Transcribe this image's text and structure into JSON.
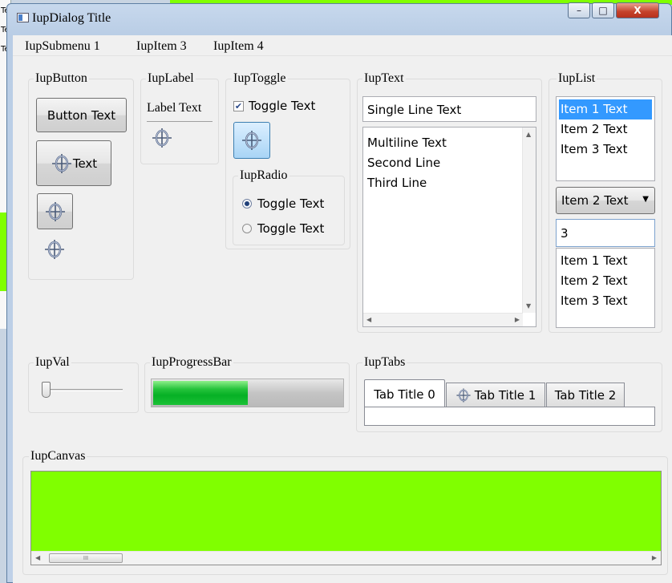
{
  "window": {
    "title": "IupDialog Title",
    "minimize": "–",
    "maximize": "□",
    "close": "X"
  },
  "menu": [
    "IupSubmenu 1",
    "IupItem 3",
    "IupItem 4"
  ],
  "button_group": {
    "label": "IupButton",
    "text_button": "Button Text",
    "icon_text_button": "Text"
  },
  "label_group": {
    "label": "IupLabel",
    "text": "Label Text"
  },
  "toggle_group": {
    "label": "IupToggle",
    "check_label": "Toggle Text",
    "checked": true
  },
  "radio_group": {
    "label": "IupRadio",
    "options": [
      {
        "label": "Toggle Text",
        "selected": true
      },
      {
        "label": "Toggle Text",
        "selected": false
      }
    ]
  },
  "text_group": {
    "label": "IupText",
    "single_line": "Single Line Text",
    "multiline": [
      "Multiline Text",
      "Second Line",
      "Third Line"
    ]
  },
  "list_group": {
    "label": "IupList",
    "list_items": [
      "Item 1 Text",
      "Item 2 Text",
      "Item 3 Text"
    ],
    "selected_index": 0,
    "dropdown_value": "Item 2 Text",
    "edit_value": "3",
    "edit_list_items": [
      "Item 1 Text",
      "Item 2 Text",
      "Item 3 Text"
    ]
  },
  "val_group": {
    "label": "IupVal",
    "value": 0.0
  },
  "progress_group": {
    "label": "IupProgressBar",
    "value": 0.5
  },
  "tabs_group": {
    "label": "IupTabs",
    "tabs": [
      "Tab Title 0",
      "Tab Title 1",
      "Tab Title 2"
    ],
    "selected": 0
  },
  "canvas_group": {
    "label": "IupCanvas",
    "color": "#80ff00",
    "scroll_grip": "III"
  },
  "colors": {
    "accent": "#3399ff",
    "canvas": "#80ff00",
    "progress": "#06b025"
  },
  "background_window": {
    "snippets": [
      "Te",
      "Te",
      "Te"
    ]
  }
}
